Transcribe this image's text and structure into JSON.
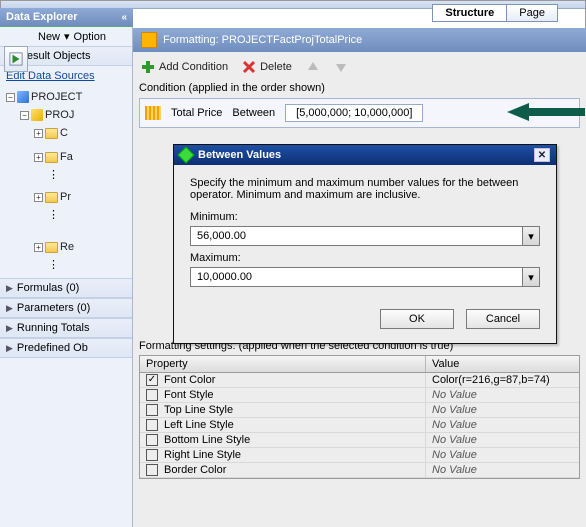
{
  "tabs": {
    "structure": "Structure",
    "page": "Page"
  },
  "explorer": {
    "title": "Data Explorer",
    "menu": {
      "new": "New",
      "options": "Option"
    },
    "result_objects": "Result Objects",
    "edit_link": "Edit Data Sources",
    "tree": {
      "root": "PROJECT",
      "child": "PROJ",
      "folders": [
        "C",
        "Fa",
        "Pr",
        "Re"
      ]
    },
    "bottom": [
      "Formulas (0)",
      "Parameters (0)",
      "Running Totals",
      "Predefined Ob"
    ]
  },
  "format": {
    "title": "Formatting: PROJECTFactProjTotalPrice",
    "add": "Add Condition",
    "delete": "Delete",
    "cond_label": "Condition (applied in the order shown)",
    "row": {
      "field": "Total Price",
      "op": "Between",
      "val": "[5,000,000; 10,000,000]"
    },
    "settings_label": "Formatting settings: (applied when the selected condition is true)",
    "headers": {
      "prop": "Property",
      "val": "Value"
    },
    "rows": [
      {
        "checked": true,
        "prop": "Font Color",
        "val": "Color(r=216,g=87,b=74)",
        "normal": true
      },
      {
        "checked": false,
        "prop": "Font Style",
        "val": "No Value"
      },
      {
        "checked": false,
        "prop": "Top Line Style",
        "val": "No Value"
      },
      {
        "checked": false,
        "prop": "Left Line Style",
        "val": "No Value"
      },
      {
        "checked": false,
        "prop": "Bottom Line Style",
        "val": "No Value"
      },
      {
        "checked": false,
        "prop": "Right Line Style",
        "val": "No Value"
      },
      {
        "checked": false,
        "prop": "Border Color",
        "val": "No Value"
      }
    ]
  },
  "dialog": {
    "title": "Between Values",
    "desc": "Specify the minimum and maximum number values for the between operator. Minimum and maximum are inclusive.",
    "min_label": "Minimum:",
    "min_value": "56,000.00",
    "max_label": "Maximum:",
    "max_value": "10,0000.00",
    "ok": "OK",
    "cancel": "Cancel"
  }
}
